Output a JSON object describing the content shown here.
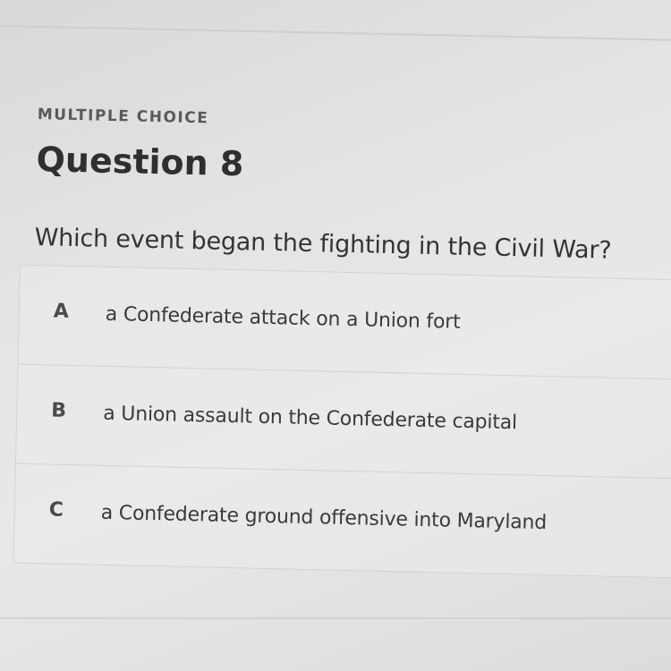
{
  "question": {
    "type_label": "MULTIPLE CHOICE",
    "title": "Question 8",
    "text": "Which event began the fighting in the Civil War?"
  },
  "choices": [
    {
      "letter": "A",
      "text": "a Confederate attack on a Union fort"
    },
    {
      "letter": "B",
      "text": "a Union assault on the Confederate capital"
    },
    {
      "letter": "C",
      "text": "a Confederate ground offensive into Maryland"
    }
  ]
}
